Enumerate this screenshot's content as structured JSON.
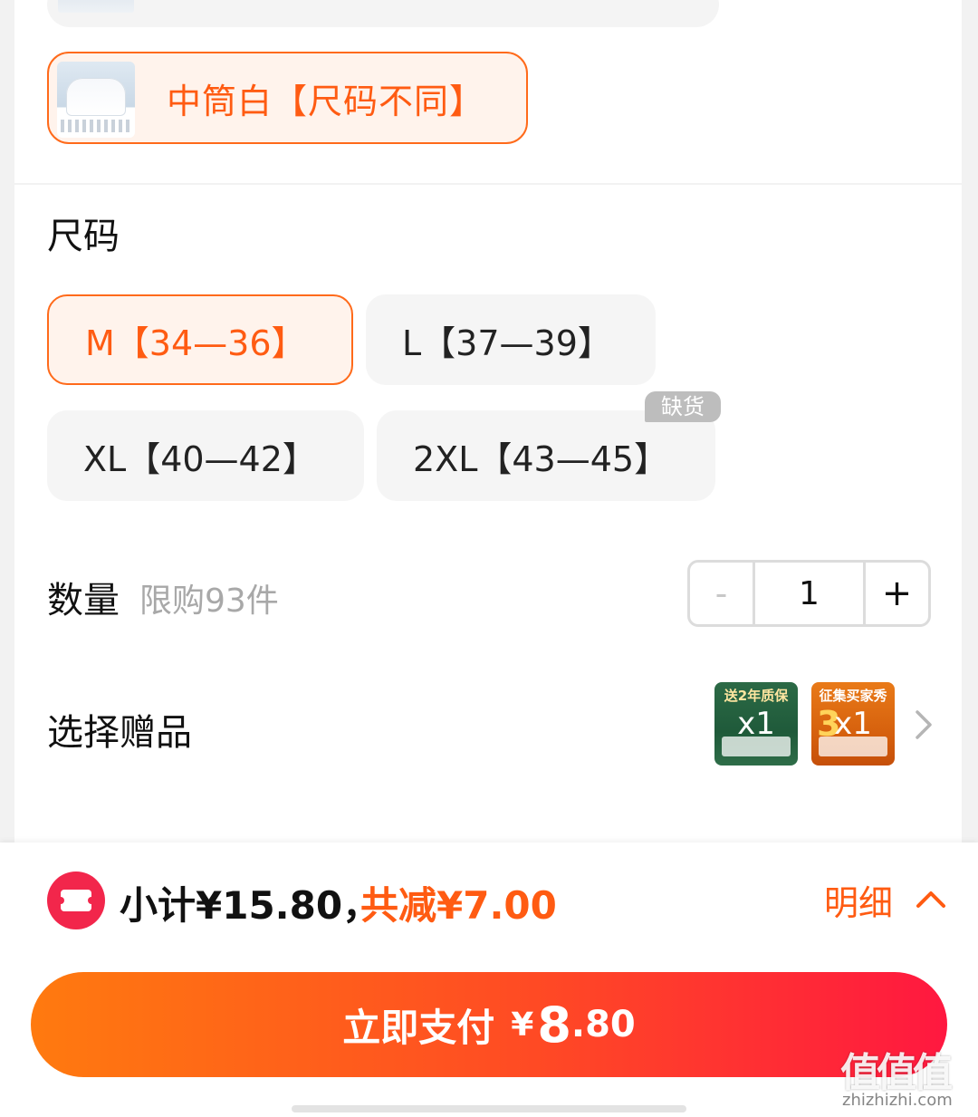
{
  "variant": {
    "selected_label": "中筒白【尺码不同】"
  },
  "size_section": {
    "title": "尺码",
    "options": [
      {
        "label": "M【34—36】",
        "selected": true
      },
      {
        "label": "L【37—39】",
        "selected": false
      },
      {
        "label": "XL【40—42】",
        "selected": false
      },
      {
        "label": "2XL【43—45】",
        "selected": false,
        "badge": "缺货"
      }
    ]
  },
  "quantity": {
    "label": "数量",
    "limit": "限购93件",
    "minus": "-",
    "value": "1",
    "plus": "+"
  },
  "gifts": {
    "label": "选择赠品",
    "items": [
      {
        "title": "送2年质保",
        "qty": "x1"
      },
      {
        "title": "征集买家秀",
        "qty": "x1",
        "accent": "3"
      }
    ]
  },
  "summary": {
    "subtotal": "小计¥15.80，",
    "discount": "共减¥7.00",
    "detail": "明细"
  },
  "pay_button": {
    "label": "立即支付",
    "currency": "¥",
    "amount_int": "8",
    "amount_dec": ".80"
  },
  "watermark": {
    "text": "值值值",
    "url": "zhizhizhi.com"
  },
  "colors": {
    "accent": "#ff5b12",
    "pay_start": "#ff7a0f",
    "pay_end": "#ff1840",
    "coupon_icon": "#f2264b"
  },
  "icons": [
    "coupon-icon",
    "chevron-right-icon",
    "chevron-up-icon"
  ]
}
